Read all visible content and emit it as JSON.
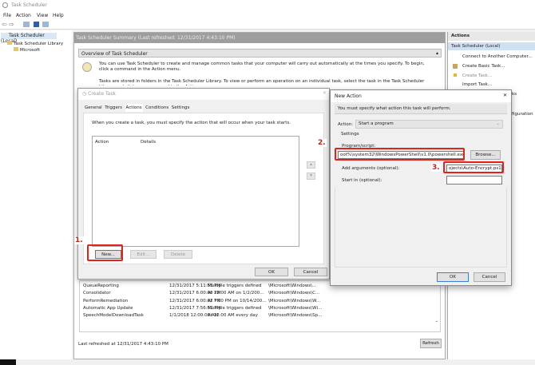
{
  "window": {
    "title": "Task Scheduler"
  },
  "menu": [
    "File",
    "Action",
    "View",
    "Help"
  ],
  "tree": {
    "root": "Task Scheduler (Local)",
    "library": "Task Scheduler Library",
    "child": "Microsoft"
  },
  "center": {
    "header": "Task Scheduler Summary (Last refreshed: 12/31/2017 4:43:10 PM)",
    "overview_title": "Overview of Task Scheduler",
    "overview_p1": "You can use Task Scheduler to create and manage common tasks that your computer will carry out automatically at the times you specify. To begin, click a command in the Action menu.",
    "overview_p2": "Tasks are stored in folders in the Task Scheduler Library. To view or perform an operation on an individual task, select the task in the Task Scheduler Library and click on a command in the Action menu.",
    "tasks": [
      [
        "QueueReporting",
        "12/31/2017 5:11:53 PM",
        "Multiple triggers defined",
        "\\Microsoft\\Windows\\..."
      ],
      [
        "Consolidator",
        "12/31/2017 6:00:00 PM",
        "At 12:00 AM on 1/2/200...",
        "\\Microsoft\\Windows\\C..."
      ],
      [
        "PerformRemediation",
        "12/31/2017 6:00:02 PM",
        "At 7:00 PM on 10/14/200...",
        "\\Microsoft\\Windows\\W..."
      ],
      [
        "Automatic App Update",
        "12/31/2017 7:56:52 PM",
        "Multiple triggers defined",
        "\\Microsoft\\Windows\\Wi..."
      ],
      [
        "SpeechModelDownloadTask",
        "1/1/2018 12:00:00 AM",
        "At 12:00 AM every day",
        "\\Microsoft\\Windows\\Sp..."
      ]
    ],
    "last_refreshed": "Last refreshed at 12/31/2017 4:43:10 PM",
    "refresh": "Refresh"
  },
  "actions": {
    "title": "Actions",
    "section": "Task Scheduler (Local)",
    "items": [
      "Connect to Another Computer...",
      "Create Basic Task...",
      "Create Task...",
      "Import Task...",
      "ks",
      "figuration"
    ]
  },
  "create_task": {
    "title": "Create Task",
    "tabs": [
      "General",
      "Triggers",
      "Actions",
      "Conditions",
      "Settings"
    ],
    "desc": "When you create a task, you must specify the action that will occur when your task starts.",
    "col_action": "Action",
    "col_details": "Details",
    "new": "New...",
    "edit": "Edit...",
    "delete": "Delete",
    "ok": "OK",
    "cancel": "Cancel"
  },
  "new_action": {
    "title": "New Action",
    "message": "You must specify what action this task will perform.",
    "action_label": "Action:",
    "action_value": "Start a program",
    "settings": "Settings",
    "program_label": "Program/script:",
    "program_value": "oot%\\system32\\WindowsPowerShell\\v1.0\\powershell.exe",
    "browse": "Browse...",
    "args_label": "Add arguments (optional):",
    "args_value": "ojects\\Auto-Encrypt.ps1",
    "start_label": "Start in (optional):",
    "ok": "OK",
    "cancel": "Cancel"
  },
  "steps": [
    "1.",
    "2.",
    "3."
  ]
}
